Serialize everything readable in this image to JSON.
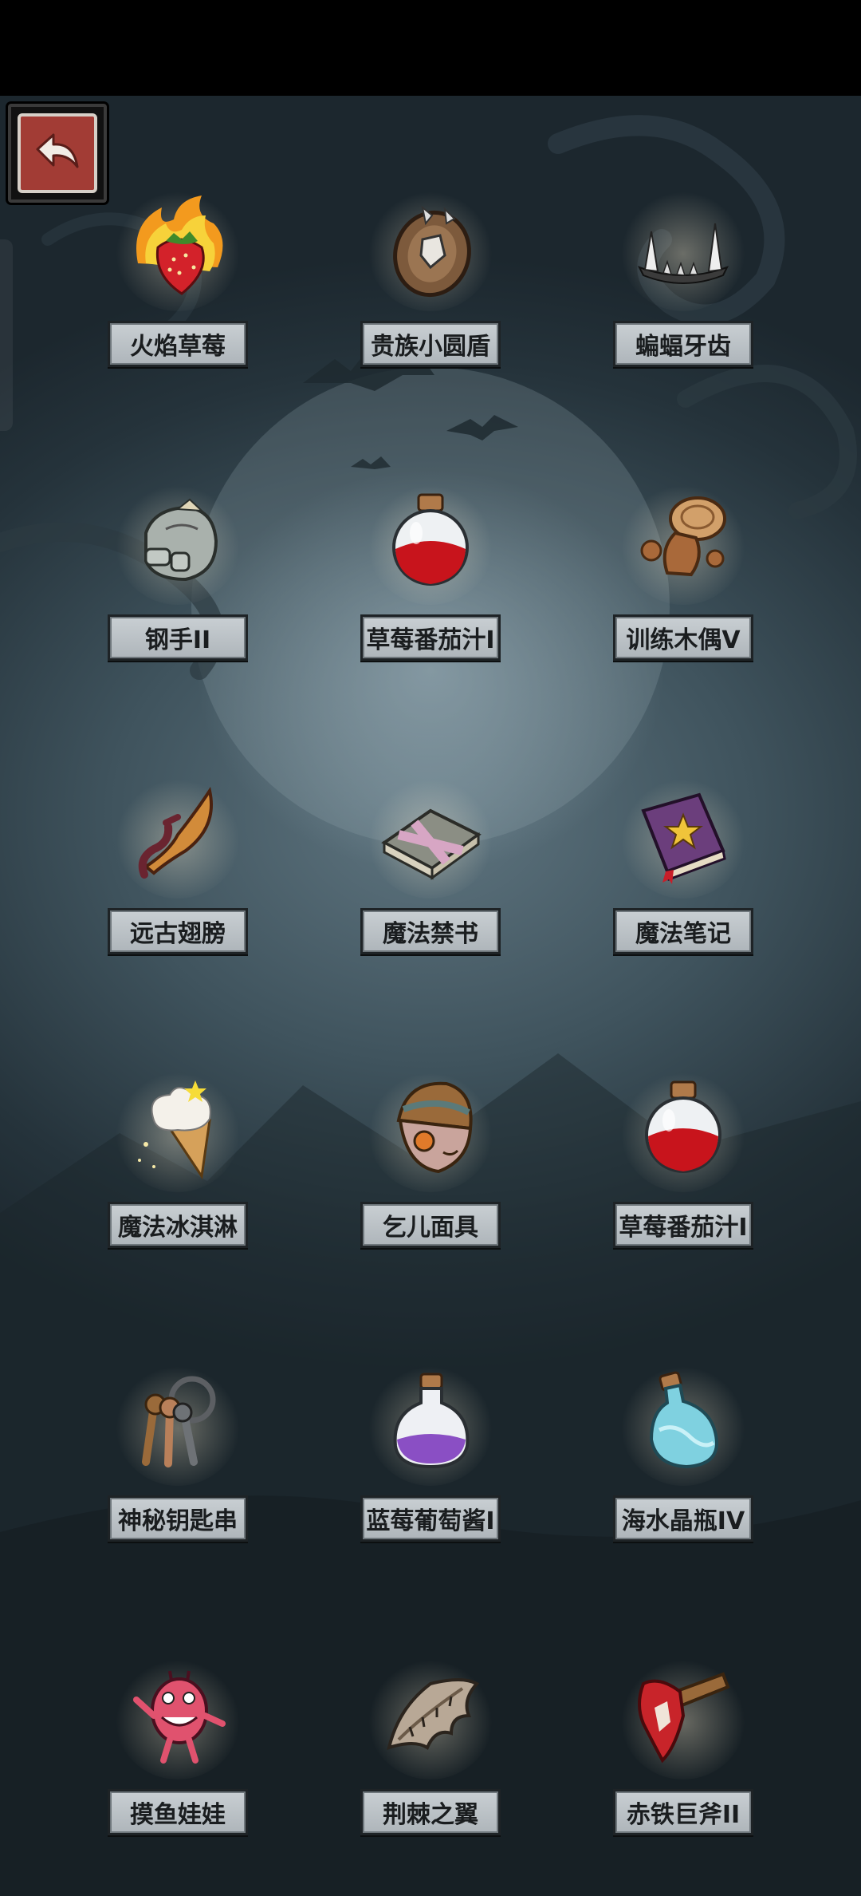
{
  "screen": {
    "back_label": ""
  },
  "items": [
    {
      "name": "火焰草莓",
      "icon": "flaming-strawberry-icon"
    },
    {
      "name": "贵族小圆盾",
      "icon": "round-shield-icon"
    },
    {
      "name": "蝙蝠牙齿",
      "icon": "bat-teeth-icon"
    },
    {
      "name": "钢手II",
      "icon": "steel-gauntlet-icon"
    },
    {
      "name": "草莓番茄汁I",
      "icon": "red-potion-icon"
    },
    {
      "name": "训练木偶V",
      "icon": "training-dummy-icon"
    },
    {
      "name": "远古翅膀",
      "icon": "ancient-wing-icon"
    },
    {
      "name": "魔法禁书",
      "icon": "forbidden-book-icon"
    },
    {
      "name": "魔法笔记",
      "icon": "magic-notebook-icon"
    },
    {
      "name": "魔法冰淇淋",
      "icon": "magic-ice-cream-icon"
    },
    {
      "name": "乞儿面具",
      "icon": "beggar-mask-icon"
    },
    {
      "name": "草莓番茄汁I",
      "icon": "red-potion-icon"
    },
    {
      "name": "神秘钥匙串",
      "icon": "key-ring-icon"
    },
    {
      "name": "蓝莓葡萄酱I",
      "icon": "purple-potion-icon"
    },
    {
      "name": "海水晶瓶IV",
      "icon": "blue-crystal-bottle-icon"
    },
    {
      "name": "摸鱼娃娃",
      "icon": "pink-doll-icon"
    },
    {
      "name": "荆棘之翼",
      "icon": "thorn-wing-icon"
    },
    {
      "name": "赤铁巨斧II",
      "icon": "red-iron-axe-icon"
    }
  ],
  "colors": {
    "label_bg": "#bfc6cb",
    "back_button": "#a23c35",
    "background": "#3f535d"
  }
}
